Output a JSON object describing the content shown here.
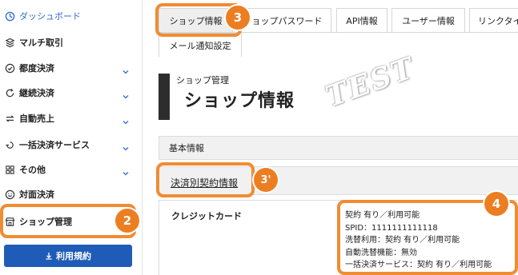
{
  "sidebar": {
    "items": [
      {
        "label": "ダッシュボード",
        "icon": "dashboard-icon",
        "active": true
      },
      {
        "label": "マルチ取引",
        "icon": "multi-transaction-icon"
      },
      {
        "label": "都度決済",
        "icon": "one-time-payment-icon",
        "expandable": true
      },
      {
        "label": "継続決済",
        "icon": "recurring-payment-icon",
        "expandable": true
      },
      {
        "label": "自動売上",
        "icon": "auto-sales-icon",
        "expandable": true
      },
      {
        "label": "一括決済サービス",
        "icon": "batch-payment-icon",
        "expandable": true
      },
      {
        "label": "その他",
        "icon": "grid-icon",
        "expandable": true
      },
      {
        "label": "対面決済",
        "icon": "face-to-face-icon"
      },
      {
        "label": "ショップ管理",
        "icon": "shop-icon"
      }
    ],
    "terms_button": "利用規約"
  },
  "tabs": [
    {
      "label": "ショップ情報",
      "active": true
    },
    {
      "label": "ショップパスワード"
    },
    {
      "label": "API情報"
    },
    {
      "label": "ユーザー情報"
    },
    {
      "label": "リンクタイ"
    },
    {
      "label": "メール通知設定"
    }
  ],
  "page": {
    "subtitle": "ショップ管理",
    "title": "ショップ情報",
    "watermark": "TEST"
  },
  "sections": {
    "basic": "基本情報",
    "contract": "決済別契約情報"
  },
  "table": {
    "row_label": "クレジットカード",
    "details": [
      "契約 有り／利用可能",
      "SPID：1111111111118",
      "洗替利用：契約 有り／利用可能",
      "自動洗替機能：無効",
      "一括決済サービス：契約 有り／利用可能"
    ]
  },
  "annotations": {
    "badge_2": "2",
    "badge_3": "3",
    "badge_3p": "3'",
    "badge_4": "4"
  },
  "colors": {
    "accent": "#f08c32",
    "primary_button": "#1f5cb8",
    "active_link": "#2f6ed1"
  }
}
